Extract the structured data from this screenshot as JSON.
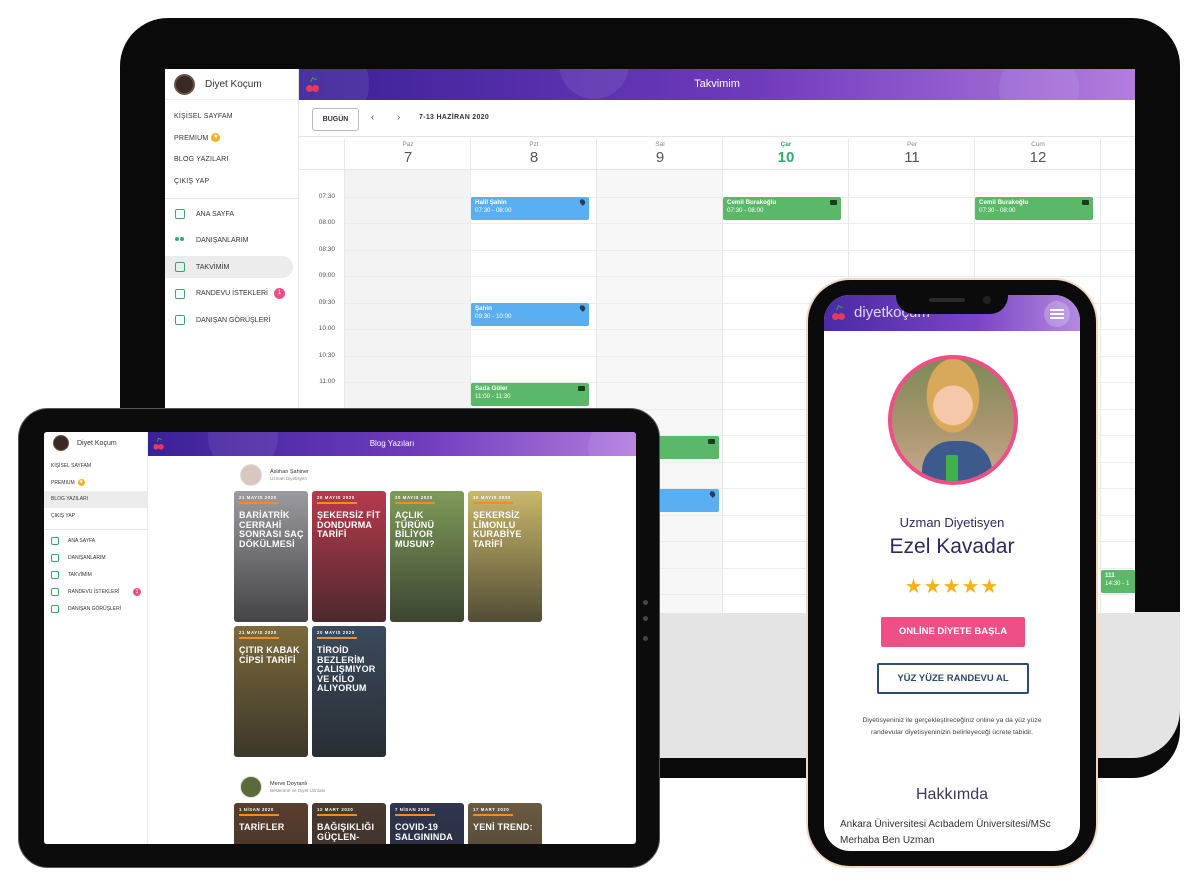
{
  "desktop": {
    "brand": "Diyet Koçum",
    "links": [
      "KİŞİSEL SAYFAM",
      "PREMIUM",
      "BLOG YAZILARI",
      "ÇIKIŞ YAP"
    ],
    "nav": [
      "ANA SAYFA",
      "DANIŞANLARIM",
      "TAKVİMİM",
      "RANDEVU İSTEKLERİ",
      "DANIŞAN GÖRÜŞLERİ"
    ],
    "requests_badge": "1",
    "header_title": "Takvimim",
    "today_button": "BUGÜN",
    "prev": "‹",
    "next": "›",
    "date_range": "7-13 HAZİRAN 2020",
    "days": [
      {
        "name": "Paz",
        "num": "7"
      },
      {
        "name": "Pzt",
        "num": "8"
      },
      {
        "name": "Sal",
        "num": "9"
      },
      {
        "name": "Çar",
        "num": "10"
      },
      {
        "name": "Per",
        "num": "11"
      },
      {
        "name": "Cum",
        "num": "12"
      }
    ],
    "times": [
      "07:30",
      "08:00",
      "08:30",
      "09:00",
      "09:30",
      "10:00",
      "10:30",
      "11:00"
    ],
    "events": {
      "e1": {
        "name": "Halil Şahin",
        "time": "07:30  -  08:00"
      },
      "e2": {
        "name": "Cemil Burakoğlu",
        "time": "07:30  -  08:00"
      },
      "e3": {
        "name": "Cemil Burakoğlu",
        "time": "07:30  -  08:00"
      },
      "e4": {
        "name": "Şahin",
        "time": "09:30  -  10:00"
      },
      "e5": {
        "name": "Sada Güler",
        "time": "11:00  -  11:30"
      },
      "e6": {
        "name": "111",
        "time": "14:30  -  1"
      }
    }
  },
  "tablet": {
    "brand": "Diyet Koçum",
    "links": [
      "KİŞİSEL SAYFAM",
      "PREMIUM",
      "BLOG YAZILARI",
      "ÇIKIŞ YAP"
    ],
    "nav": [
      "ANA SAYFA",
      "DANIŞANLARIM",
      "TAKVİMİM",
      "RANDEVU İSTEKLERİ",
      "DANIŞAN GÖRÜŞLERİ"
    ],
    "requests_badge": "1",
    "header_title": "Blog Yazıları",
    "author1": {
      "name": "Aslıhan Şahiner",
      "title": "Uzman Diyetisyen"
    },
    "author2": {
      "name": "Merve Doyranlı",
      "title": "Beslenme ve Diyet Uzmanı"
    },
    "cards": [
      {
        "date": "21 MAYIS 2020",
        "title": "BARİATRİK CERRAHİ SONRASI SAÇ DÖKÜLMESİ",
        "bg": "#9a9aa0"
      },
      {
        "date": "20 MAYIS 2020",
        "title": "ŞEKERSİZ FİT DONDURMA TARİFİ",
        "bg": "#b73a4d"
      },
      {
        "date": "20 MAYIS 2020",
        "title": "AÇLIK TÜRÜNÜ BİLİYOR MUSUN?",
        "bg": "#7f9b58"
      },
      {
        "date": "20 MAYIS 2020",
        "title": "ŞEKERSİZ LİMONLU KURABİYE TARİFİ",
        "bg": "#c9b76a"
      },
      {
        "date": "21 MAYIS 2020",
        "title": "ÇITIR KABAK CİPSİ TARİFİ",
        "bg": "#7c6a3c"
      },
      {
        "date": "20 MAYIS 2020",
        "title": "TİROİD BEZLERİM ÇALIŞMIYOR VE KİLO ALIYORUM",
        "bg": "#3b4a5e"
      },
      {
        "date": "1 NİSAN 2020",
        "title": "TARİFLER",
        "bg": "#5a3e2e"
      },
      {
        "date": "12 MART 2020",
        "title": "BAĞIŞIKLIĞI GÜÇLEN-",
        "bg": "#4a3a30"
      },
      {
        "date": "7 NİSAN 2020",
        "title": "COVID-19 SALGININDA",
        "bg": "#2f3550"
      },
      {
        "date": "17 MART 2020",
        "title": "YENİ TREND:",
        "bg": "#6a5a40"
      }
    ]
  },
  "phone": {
    "logo": "diyetkoçum",
    "role": "Uzman Diyetisyen",
    "name": "Ezel Kavadar",
    "rating": 5,
    "stars_text": "★★★★★",
    "online_button": "ONLİNE DİYETE BAŞLA",
    "inperson_button": "YÜZ YÜZE RANDEVU AL",
    "note": "Diyetisyeniniz ile gerçekleştireceğiniz online ya da yüz yüze randevular diyetisyeninizin belirleyeceği ücrete tabidir.",
    "about_title": "Hakkımda",
    "bio": "Ankara Üniversitesi Acıbadem Üniversitesi/MSc Merhaba Ben Uzman"
  },
  "colors": {
    "header_gradient_start": "#3a2198",
    "header_gradient_end": "#b37cde",
    "accent_green": "#35a86b",
    "event_blue": "#5aaef2",
    "event_green": "#5bb868",
    "pink": "#ee4f87",
    "star": "#f6b21b"
  }
}
